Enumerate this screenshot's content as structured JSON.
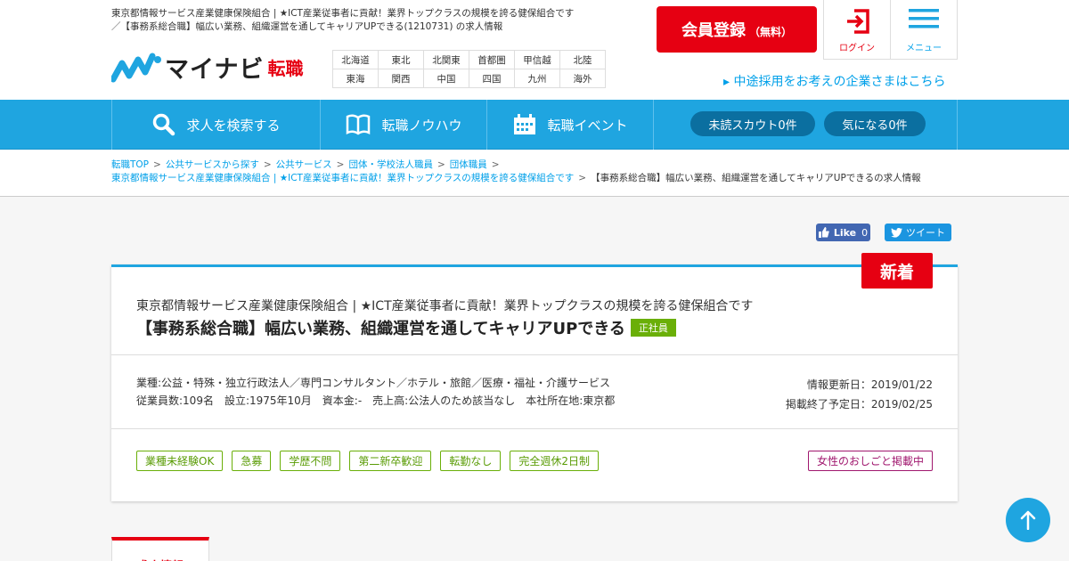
{
  "header": {
    "description": "東京都情報サービス産業健康保険組合 | ★ICT産業従事者に貢献！業界トップクラスの規模を誇る健保組合です／【事務系総合職】幅広い業務、組織運営を通してキャリアUPできる(1210731) の求人情報",
    "logo_main": "マイナビ",
    "logo_sub": "転職",
    "regions_row1": [
      "北海道",
      "東北",
      "北関東",
      "首都圏",
      "甲信越",
      "北陸"
    ],
    "regions_row2": [
      "東海",
      "関西",
      "中国",
      "四国",
      "九州",
      "海外"
    ],
    "register_main": "会員登録",
    "register_sub": "（無料）",
    "login_label": "ログイン",
    "menu_label": "メニュー",
    "corp_link": "▸ 中途採用をお考えの企業さまはこちら",
    "brand_color": "#e60012",
    "accent_color": "#1fa5e0"
  },
  "nav": {
    "search": "求人を検索する",
    "knowhow": "転職ノウハウ",
    "event": "転職イベント",
    "scout": "未読スカウト0件",
    "favorites": "気になる0件"
  },
  "breadcrumb": {
    "items": [
      "転職TOP",
      "公共サービスから探す",
      "公共サービス",
      "団体・学校法人職員",
      "団体職員"
    ],
    "company_link": "東京都情報サービス産業健康保険組合 | ★ICT産業従事者に貢献！業界トップクラスの規模を誇る健保組合です",
    "current": "【事務系総合職】幅広い業務、組織運営を通してキャリアUPできるの求人情報",
    "separator": ">"
  },
  "social": {
    "like_label": "Like",
    "like_count": "0",
    "tweet_label": "ツイート"
  },
  "job": {
    "new_badge": "新着",
    "company": "東京都情報サービス産業健康保険組合 | ★ICT産業従事者に貢献！業界トップクラスの規模を誇る健保組合です",
    "title": "【事務系総合職】幅広い業務、組織運営を通してキャリアUPできる",
    "employment_type": "正社員",
    "industry": "業種:公益・特殊・独立行政法人／専門コンサルタント／ホテル・旅館／医療・福祉・介護サービス",
    "details": "従業員数:109名　設立:1975年10月　資本金:-　売上高:公法人のため該当なし　本社所在地:東京都",
    "updated": "情報更新日：2019/01/22",
    "end_date": "掲載終了予定日：2019/02/25",
    "tags": [
      "業種未経験OK",
      "急募",
      "学歴不問",
      "第二新卒歓迎",
      "転勤なし",
      "完全週休2日制"
    ],
    "women_tag": "女性のおしごと掲載中"
  },
  "tabs": {
    "job_info": "求人情報"
  }
}
